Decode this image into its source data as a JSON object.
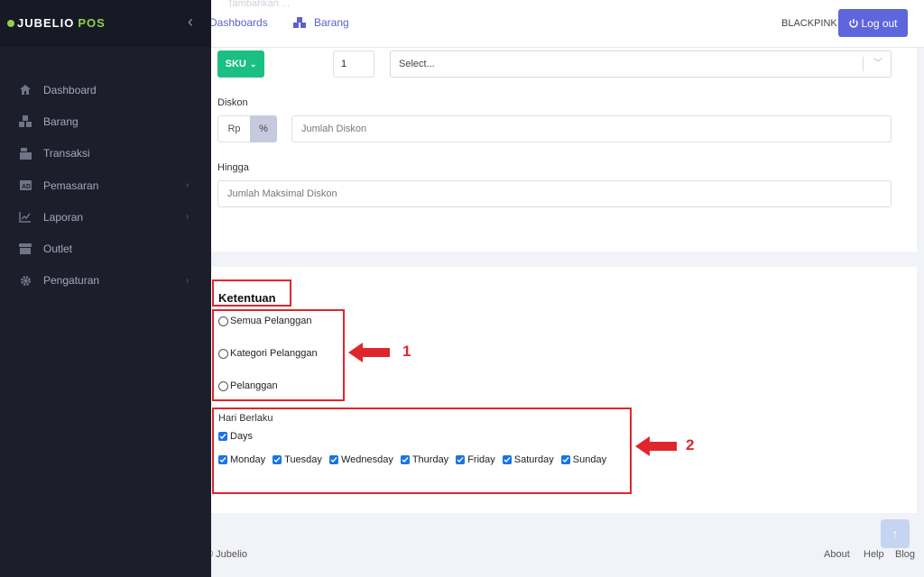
{
  "app": {
    "brand": "JUBELIO",
    "brand_suffix": "POS"
  },
  "sidebar": {
    "items": [
      {
        "label": "Dashboard",
        "icon": "home-icon",
        "has_submenu": false
      },
      {
        "label": "Barang",
        "icon": "boxes-icon",
        "has_submenu": false
      },
      {
        "label": "Transaksi",
        "icon": "cash-register-icon",
        "has_submenu": false
      },
      {
        "label": "Pemasaran",
        "icon": "ad-icon",
        "has_submenu": true
      },
      {
        "label": "Laporan",
        "icon": "chart-line-icon",
        "has_submenu": true
      },
      {
        "label": "Outlet",
        "icon": "store-icon",
        "has_submenu": false
      },
      {
        "label": "Pengaturan",
        "icon": "gear-icon",
        "has_submenu": true
      }
    ]
  },
  "topbar": {
    "ghost_text": "Tambahkan ...",
    "breadcrumb": [
      {
        "label": "Dashboards"
      },
      {
        "label": "Barang"
      }
    ],
    "user": "BLACKPINK",
    "logout_label": "Log out"
  },
  "form": {
    "sku_button": "SKU",
    "qty_value": "1",
    "select_placeholder": "Select...",
    "diskon_label": "Diskon",
    "rp_label": "Rp",
    "pct_label": "%",
    "diskon_placeholder": "Jumlah Diskon",
    "hingga_label": "Hingga",
    "hingga_placeholder": "Jumlah Maksimal Diskon"
  },
  "ketentuan": {
    "title": "Ketentuan",
    "options": [
      "Semua Pelanggan",
      "Kategori Pelanggan",
      "Pelanggan"
    ],
    "hari_label": "Hari Berlaku",
    "days_all": "Days",
    "days": [
      "Monday",
      "Tuesday",
      "Wednesday",
      "Thurday",
      "Friday",
      "Saturday",
      "Sunday"
    ]
  },
  "annotations": {
    "marker_1": "1",
    "marker_2": "2",
    "color": "#e0262d"
  },
  "footer": {
    "copyright": "© Jubelio",
    "links": [
      "About",
      "Help",
      "Blog"
    ]
  }
}
